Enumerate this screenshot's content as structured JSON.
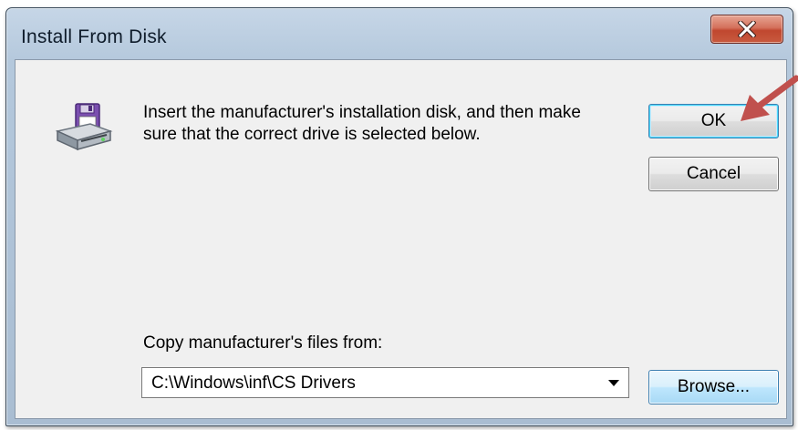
{
  "window": {
    "title": "Install From Disk",
    "close_icon": "close-x-icon"
  },
  "dialog": {
    "icon": "floppy-disk-drive-icon",
    "message": "Insert the manufacturer's installation disk, and then make sure that the correct drive is selected below.",
    "ok_label": "OK",
    "cancel_label": "Cancel",
    "copy_label": "Copy manufacturer's files from:",
    "path_value": "C:\\Windows\\inf\\CS Drivers",
    "browse_label": "Browse..."
  },
  "annotation": {
    "icon": "red-arrow-pointer",
    "color": "#c0504d"
  },
  "colors": {
    "close_button": "#c8503a",
    "client_background": "#f0f0f0",
    "frame": "#b4c8dc"
  }
}
